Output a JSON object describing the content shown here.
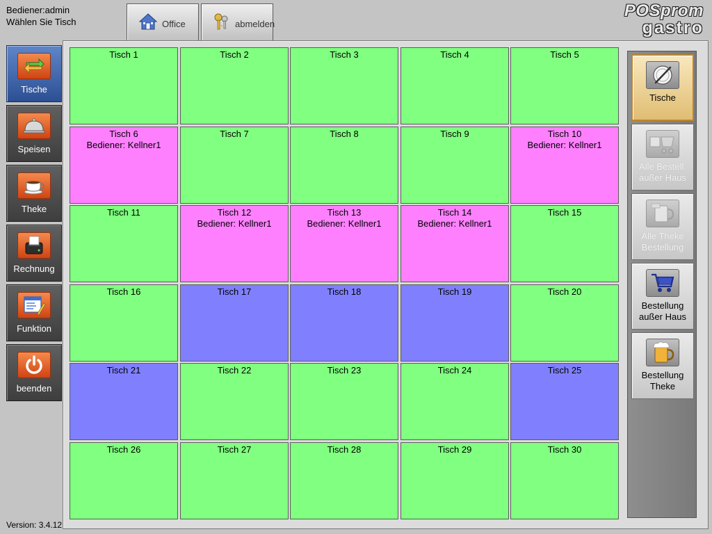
{
  "status": {
    "user_line": "Bediener:admin",
    "instruction": "Wählen Sie Tisch"
  },
  "top_buttons": {
    "office_label": "Office",
    "logout_label": "abmelden"
  },
  "logo": {
    "line1": "POSprom",
    "line2": "gastro"
  },
  "side_nav": [
    {
      "label": "Tische",
      "icon": "swap-arrows-icon",
      "active": true
    },
    {
      "label": "Speisen",
      "icon": "cloche-icon",
      "active": false
    },
    {
      "label": "Theke",
      "icon": "coffee-cup-icon",
      "active": false
    },
    {
      "label": "Rechnung",
      "icon": "receipt-printer-icon",
      "active": false
    },
    {
      "label": "Funktion",
      "icon": "window-pencil-icon",
      "active": false
    },
    {
      "label": "beenden",
      "icon": "power-icon",
      "active": false
    }
  ],
  "version": "Version: 3.4.12",
  "status_colors": {
    "free": "#80ff80",
    "occupied": "#ff80ff",
    "reserved": "#8080ff"
  },
  "tables": [
    {
      "name": "Tisch 1",
      "status": "free",
      "waiter": ""
    },
    {
      "name": "Tisch 2",
      "status": "free",
      "waiter": ""
    },
    {
      "name": "Tisch 3",
      "status": "free",
      "waiter": ""
    },
    {
      "name": "Tisch 4",
      "status": "free",
      "waiter": ""
    },
    {
      "name": "Tisch 5",
      "status": "free",
      "waiter": ""
    },
    {
      "name": "Tisch 6",
      "status": "occupied",
      "waiter": "Bediener: Kellner1"
    },
    {
      "name": "Tisch 7",
      "status": "free",
      "waiter": ""
    },
    {
      "name": "Tisch 8",
      "status": "free",
      "waiter": ""
    },
    {
      "name": "Tisch 9",
      "status": "free",
      "waiter": ""
    },
    {
      "name": "Tisch 10",
      "status": "occupied",
      "waiter": "Bediener: Kellner1"
    },
    {
      "name": "Tisch 11",
      "status": "free",
      "waiter": ""
    },
    {
      "name": "Tisch 12",
      "status": "occupied",
      "waiter": "Bediener: Kellner1"
    },
    {
      "name": "Tisch 13",
      "status": "occupied",
      "waiter": "Bediener: Kellner1"
    },
    {
      "name": "Tisch 14",
      "status": "occupied",
      "waiter": "Bediener: Kellner1"
    },
    {
      "name": "Tisch 15",
      "status": "free",
      "waiter": ""
    },
    {
      "name": "Tisch 16",
      "status": "free",
      "waiter": ""
    },
    {
      "name": "Tisch 17",
      "status": "reserved",
      "waiter": ""
    },
    {
      "name": "Tisch 18",
      "status": "reserved",
      "waiter": ""
    },
    {
      "name": "Tisch 19",
      "status": "reserved",
      "waiter": ""
    },
    {
      "name": "Tisch 20",
      "status": "free",
      "waiter": ""
    },
    {
      "name": "Tisch 21",
      "status": "reserved",
      "waiter": ""
    },
    {
      "name": "Tisch 22",
      "status": "free",
      "waiter": ""
    },
    {
      "name": "Tisch 23",
      "status": "free",
      "waiter": ""
    },
    {
      "name": "Tisch 24",
      "status": "free",
      "waiter": ""
    },
    {
      "name": "Tisch 25",
      "status": "reserved",
      "waiter": ""
    },
    {
      "name": "Tisch 26",
      "status": "free",
      "waiter": ""
    },
    {
      "name": "Tisch 27",
      "status": "free",
      "waiter": ""
    },
    {
      "name": "Tisch 28",
      "status": "free",
      "waiter": ""
    },
    {
      "name": "Tisch 29",
      "status": "free",
      "waiter": ""
    },
    {
      "name": "Tisch 30",
      "status": "free",
      "waiter": ""
    }
  ],
  "right_panel": [
    {
      "label_lines": [
        "Tische"
      ],
      "icon": "plate-knife-icon",
      "state": "active"
    },
    {
      "label_lines": [
        "Alle Bestell.",
        "außer Haus"
      ],
      "icon": "delivery-cart-icon",
      "state": "disabled"
    },
    {
      "label_lines": [
        "Alle Theke",
        "Bestellung"
      ],
      "icon": "mug-icon",
      "state": "disabled"
    },
    {
      "label_lines": [
        "Bestellung",
        "außer Haus"
      ],
      "icon": "shopping-cart-icon",
      "state": "normal"
    },
    {
      "label_lines": [
        "Bestellung",
        "Theke"
      ],
      "icon": "beer-mug-icon",
      "state": "normal"
    }
  ]
}
